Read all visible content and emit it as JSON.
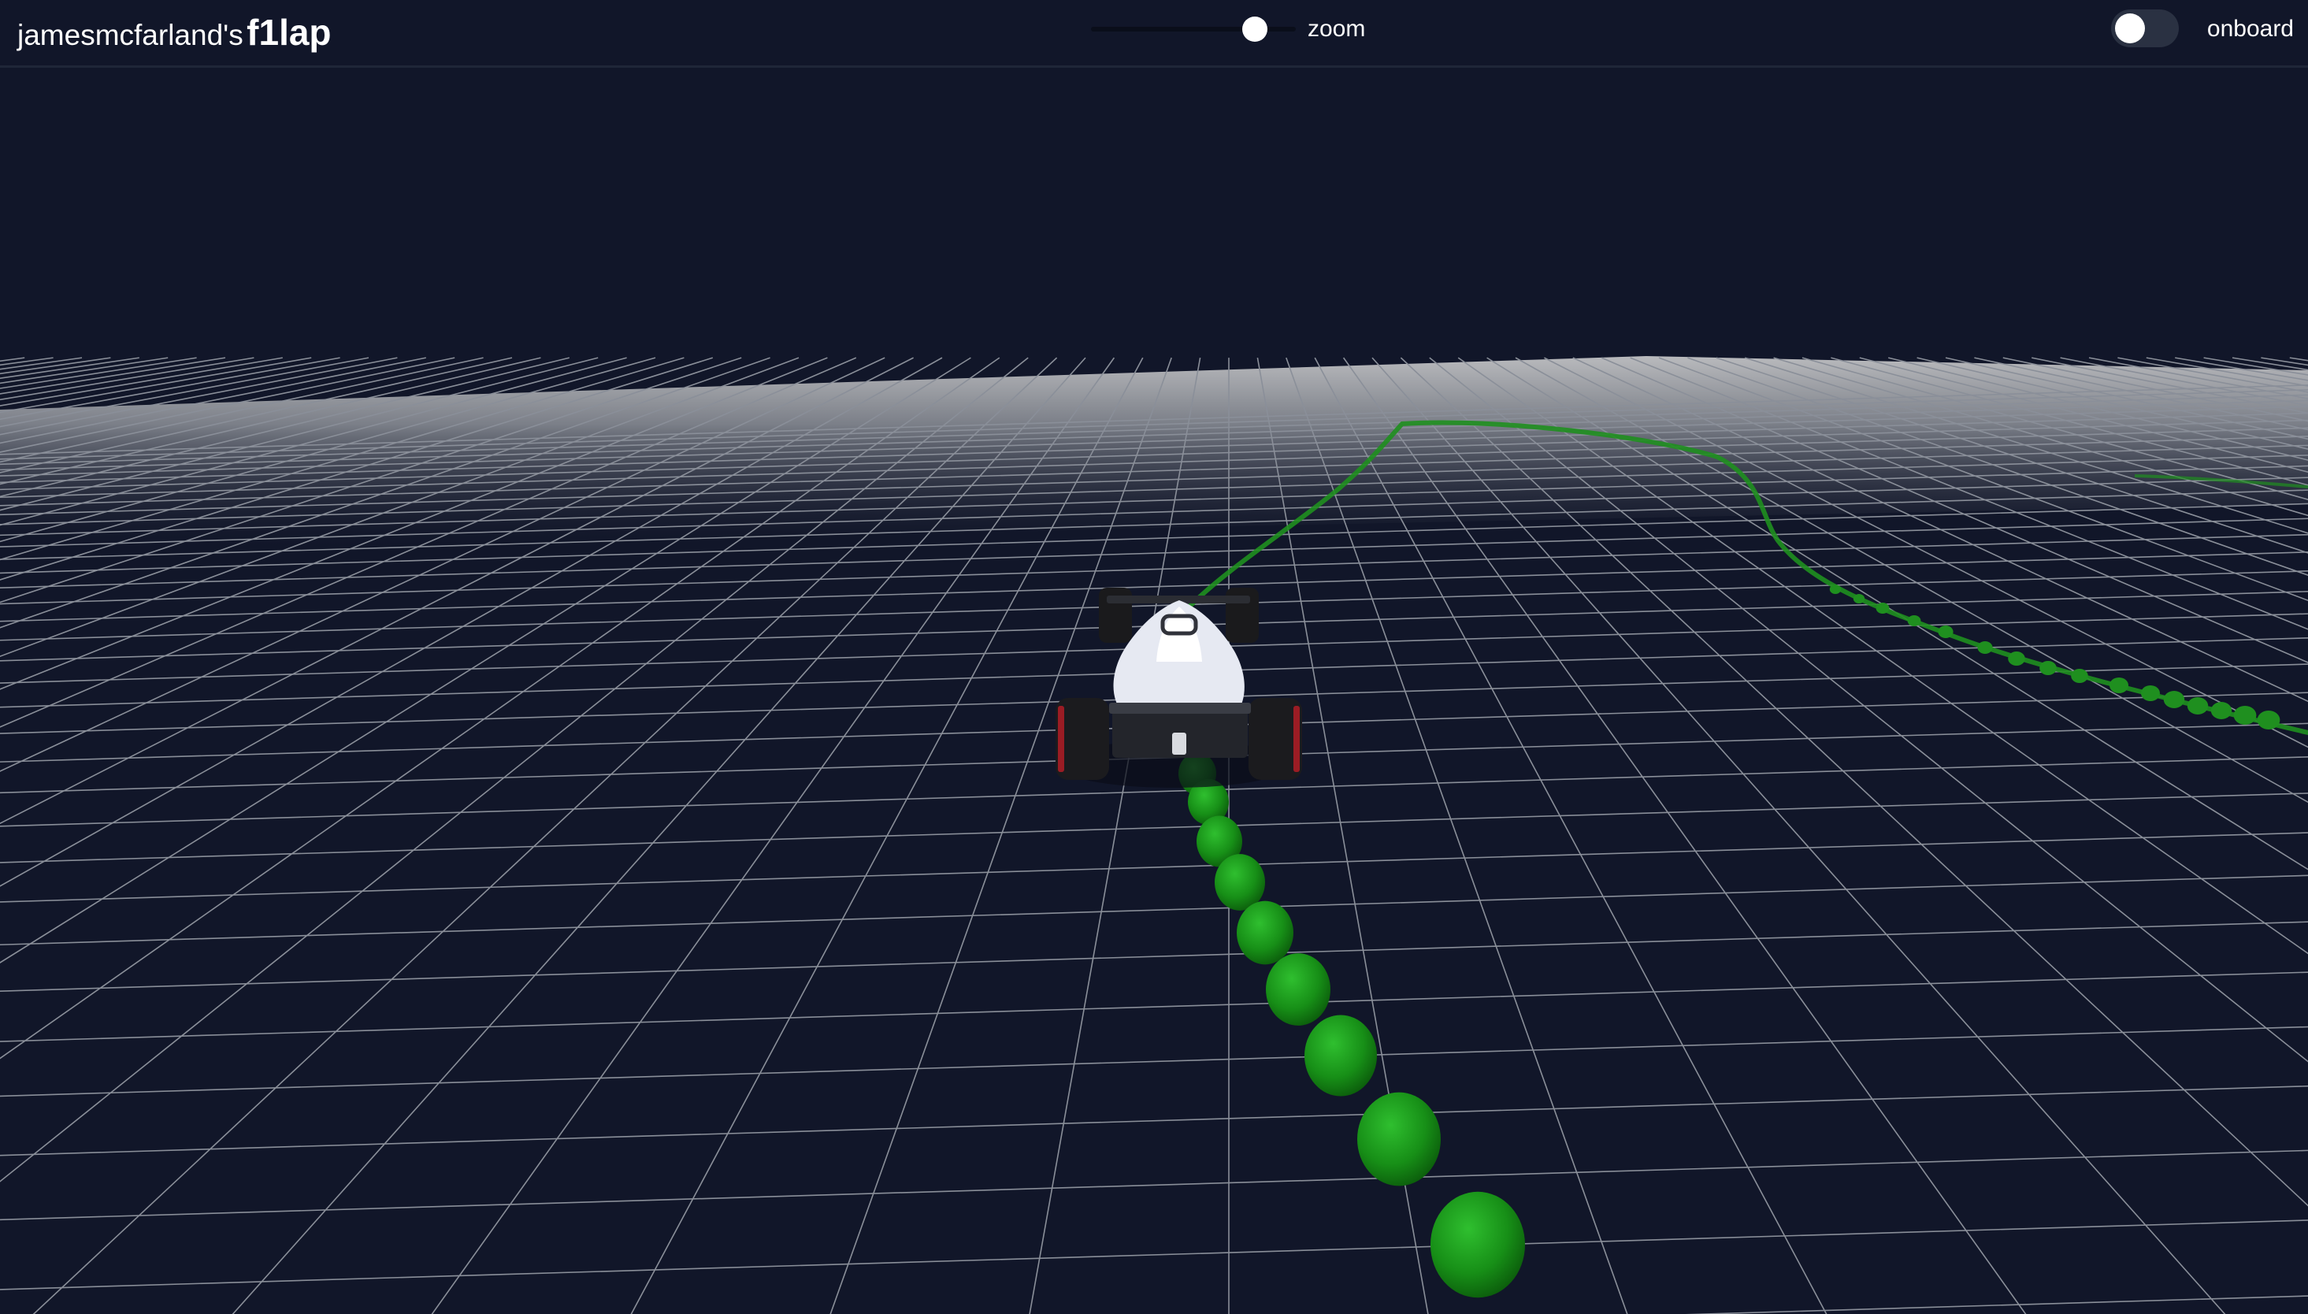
{
  "header": {
    "owner": "jamesmcfarland's",
    "app_name": "f1lap"
  },
  "zoom": {
    "label": "zoom",
    "value_fraction": 0.8
  },
  "onboard": {
    "label": "onboard",
    "enabled": false
  },
  "scene": {
    "background_color": "#111629",
    "grid_color": "#8a8f99",
    "horizon_color": "#a9aaaf",
    "track_color": "#1f8f1f",
    "car_body_color": "#e6e9f2"
  }
}
